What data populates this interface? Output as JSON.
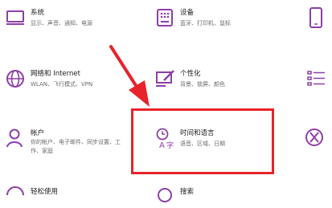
{
  "tiles": {
    "system": {
      "title": "系统",
      "subtitle": "显示、声音、通知、电源",
      "icon": "laptop-icon"
    },
    "devices": {
      "title": "设备",
      "subtitle": "蓝牙、打印机、鼠标",
      "icon": "keyboard-icon"
    },
    "network": {
      "title": "网络和 Internet",
      "subtitle": "WLAN、飞行模式、VPN",
      "icon": "globe-icon"
    },
    "personalization": {
      "title": "个性化",
      "subtitle": "背景、锁屏、颜色",
      "icon": "paintbrush-icon"
    },
    "accounts": {
      "title": "帐户",
      "subtitle": "你的帐户、电子邮件、同步设置、工作、家庭",
      "icon": "person-icon"
    },
    "time_language": {
      "title": "时间和语言",
      "subtitle": "语音、区域、日期",
      "icon": "clock-language-icon"
    },
    "ease_of_access": {
      "title": "轻松使用",
      "icon": "ease-of-access-icon"
    },
    "search": {
      "title": "搜索",
      "icon": "search-icon"
    }
  },
  "colors": {
    "accent": "#8e3fa8",
    "highlight": "#e8232b",
    "title": "#1b1b1b",
    "subtitle": "#6b6b6b"
  }
}
